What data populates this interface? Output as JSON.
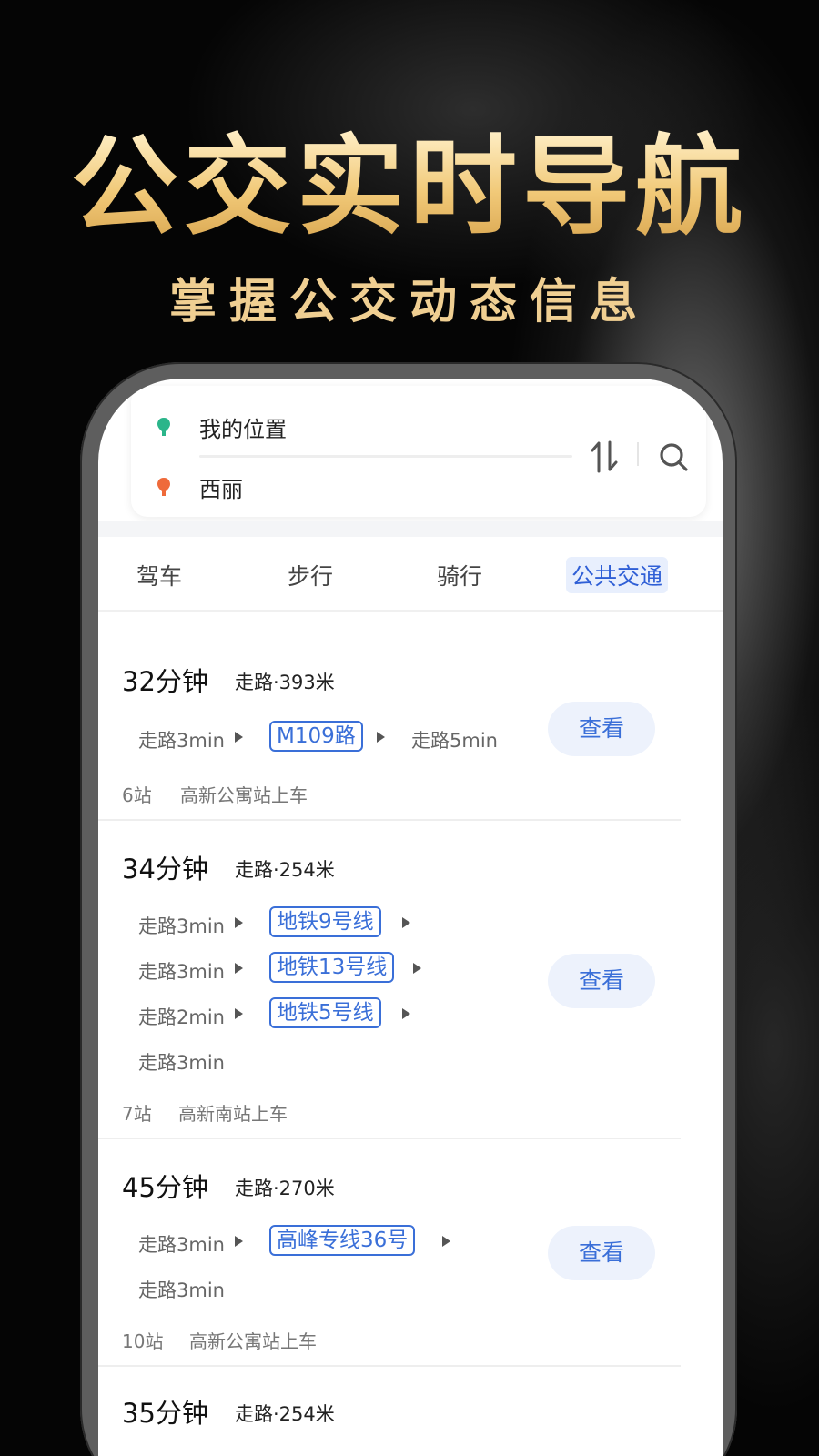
{
  "hero": {
    "title": "公交实时导航",
    "subtitle": "掌握公交动态信息"
  },
  "route_input": {
    "origin": "我的位置",
    "destination": "西丽",
    "origin_pin_color": "#2bb58a",
    "destination_pin_color": "#ef6a3a",
    "swap_icon": "swap-vertical-icon",
    "search_icon": "search-icon"
  },
  "tabs": [
    {
      "label": "驾车"
    },
    {
      "label": "步行"
    },
    {
      "label": "骑行"
    },
    {
      "label": "公共交通",
      "active": true
    }
  ],
  "results": [
    {
      "duration": "32分钟",
      "walk_total": "走路·393米",
      "rows": [
        {
          "walk": "走路3min",
          "line": "M109路",
          "after": "走路5min"
        }
      ],
      "stops": "6站",
      "board": "高新公寓站上车",
      "button": "查看"
    },
    {
      "duration": "34分钟",
      "walk_total": "走路·254米",
      "rows": [
        {
          "walk": "走路3min",
          "line": "地铁9号线"
        },
        {
          "walk": "走路3min",
          "line": "地铁13号线"
        },
        {
          "walk": "走路2min",
          "line": "地铁5号线"
        },
        {
          "walk": "走路3min"
        }
      ],
      "stops": "7站",
      "board": "高新南站上车",
      "button": "查看"
    },
    {
      "duration": "45分钟",
      "walk_total": "走路·270米",
      "rows": [
        {
          "walk": "走路3min",
          "line": "高峰专线36号"
        },
        {
          "walk": "走路3min"
        }
      ],
      "stops": "10站",
      "board": "高新公寓站上车",
      "button": "查看"
    },
    {
      "duration": "35分钟",
      "walk_total": "走路·254米"
    }
  ],
  "colors": {
    "accent_blue": "#3a6fd8",
    "gold": "#f1c978"
  }
}
